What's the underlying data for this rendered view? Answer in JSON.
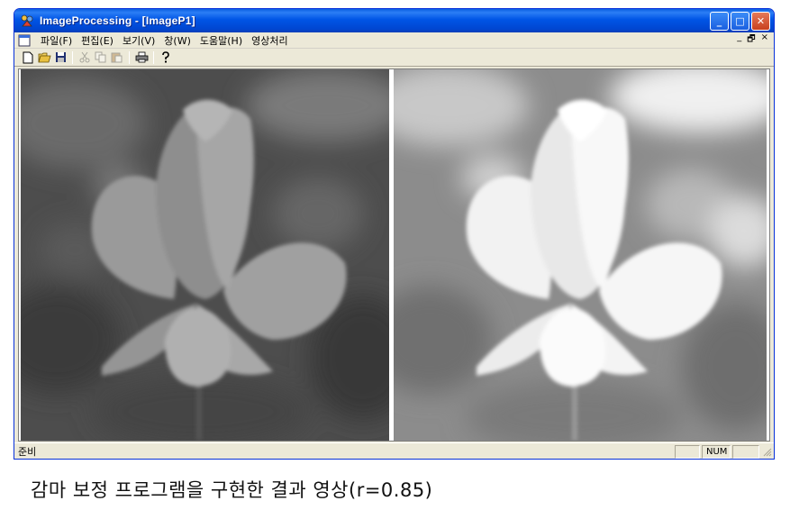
{
  "window": {
    "title": "ImageProcessing - [ImageP1]",
    "min_glyph": "_",
    "max_glyph": "□",
    "close_glyph": "✕"
  },
  "menu": {
    "items": [
      "파일(F)",
      "편집(E)",
      "보기(V)",
      "창(W)",
      "도움말(H)",
      "영상처리"
    ],
    "mdi_min": "_",
    "mdi_restore": "🗗",
    "mdi_close": "×"
  },
  "toolbar": {
    "tools": [
      "new-icon",
      "open-icon",
      "save-icon",
      "cut-icon",
      "copy-icon",
      "paste-icon",
      "print-icon",
      "help-icon"
    ]
  },
  "status": {
    "text": "준비",
    "num": "NUM"
  },
  "images": {
    "left": "original grayscale image",
    "right": "gamma corrected image"
  },
  "caption": "감마 보정 프로그램을 구현한 결과 영상(r=0.85)",
  "colors": {
    "title_blue": "#0055e5",
    "chrome": "#ece9d8",
    "close_red": "#c8401e"
  }
}
